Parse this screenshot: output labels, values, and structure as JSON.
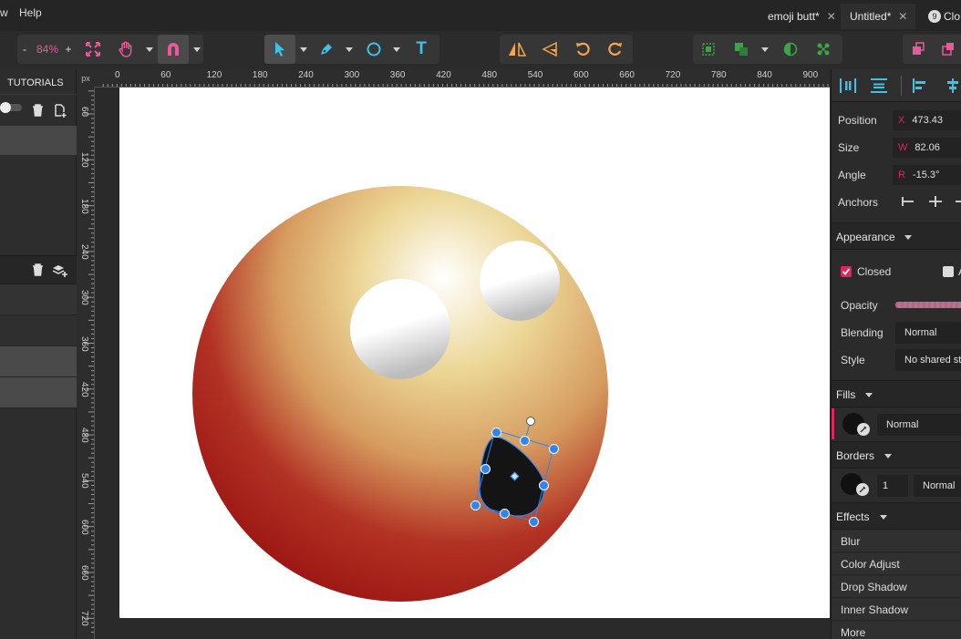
{
  "menu": {
    "view_partial": "w",
    "help": "Help"
  },
  "tabs": [
    {
      "label": "emoji butt*",
      "close": "✕"
    },
    {
      "label": "Untitled*",
      "close": "✕"
    },
    {
      "label": "Clo",
      "badge": "9"
    }
  ],
  "toolbar": {
    "zoom_minus": "-",
    "zoom_value": "84%",
    "zoom_plus": "+",
    "text_tool": "T"
  },
  "left_panel": {
    "tutorials_label": "TUTORIALS"
  },
  "ruler": {
    "unit": "px",
    "h_labels": [
      "0",
      "60",
      "120",
      "180",
      "240",
      "300",
      "360",
      "420",
      "480",
      "540",
      "600",
      "660",
      "720",
      "780",
      "840",
      "900"
    ],
    "v_labels": [
      "60",
      "120",
      "180",
      "240",
      "300",
      "360",
      "420",
      "480",
      "540",
      "600",
      "660",
      "720"
    ]
  },
  "inspector": {
    "position_label": "Position",
    "position_prefix": "X",
    "position_value": "473.43",
    "size_label": "Size",
    "size_prefix": "W",
    "size_value": "82.06",
    "angle_label": "Angle",
    "angle_prefix": "R",
    "angle_value": "-15.3°",
    "anchors_label": "Anchors"
  },
  "appearance": {
    "title": "Appearance",
    "closed_label": "Closed",
    "closed_checked": true,
    "second_check_partial": "A",
    "opacity_label": "Opacity",
    "blending_label": "Blending",
    "blending_value": "Normal",
    "style_label": "Style",
    "style_value": "No shared sty"
  },
  "fills": {
    "title": "Fills",
    "blend_value": "Normal"
  },
  "borders": {
    "title": "Borders",
    "width_value": "1",
    "blend_value": "Normal"
  },
  "effects": {
    "title": "Effects",
    "items": [
      "Blur",
      "Color Adjust",
      "Drop Shadow",
      "Inner Shadow",
      "More"
    ]
  },
  "colors": {
    "accent": "#e0245e",
    "selection": "#2f86f0",
    "tool_cyan": "#3ec3e8",
    "tool_orange": "#f2a650",
    "tool_green": "#3ea34a",
    "tool_pink": "#e85a9a"
  }
}
